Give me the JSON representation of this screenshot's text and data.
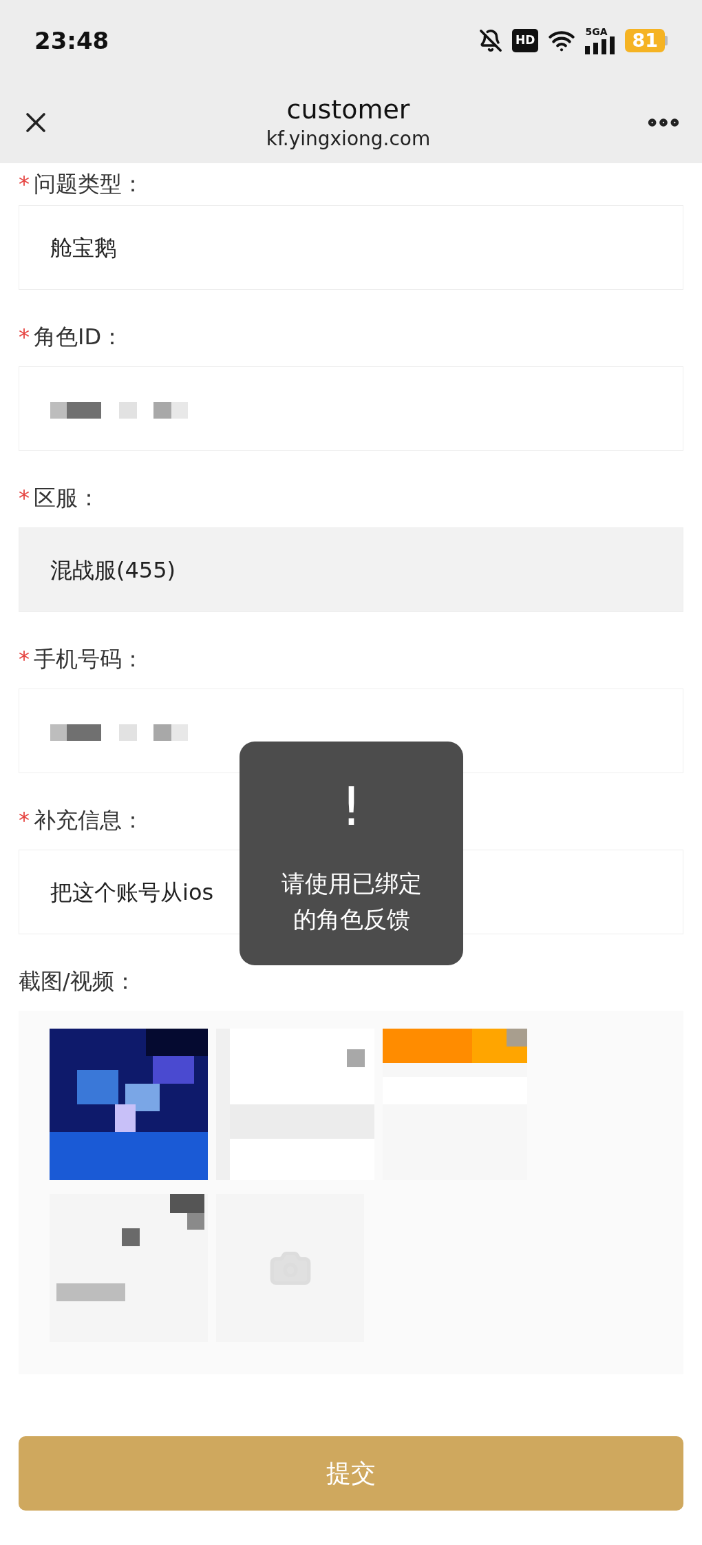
{
  "status_bar": {
    "time": "23:48",
    "hd_badge": "HD",
    "network": "5GA",
    "battery": "81"
  },
  "header": {
    "title": "customer",
    "url": "kf.yingxiong.com"
  },
  "fields": [
    {
      "marker": "*",
      "label": "问题类型：",
      "kind": "text",
      "value": "舱宝鹅",
      "disabled": false
    },
    {
      "marker": "*",
      "label": "角色ID：",
      "kind": "redacted",
      "disabled": false
    },
    {
      "marker": "*",
      "label": "区服：",
      "kind": "text",
      "value": "混战服(455)",
      "disabled": true
    },
    {
      "marker": "*",
      "label": "手机号码：",
      "kind": "redacted",
      "disabled": false
    },
    {
      "marker": "*",
      "label": "补充信息：",
      "kind": "text",
      "value": "把这个账号从ios",
      "disabled": false
    }
  ],
  "uploads": {
    "label": "截图/视频：",
    "add_photo": true
  },
  "toast": {
    "symbol": "!",
    "message": "请使用已绑定的角色反馈"
  },
  "submit": "提交"
}
